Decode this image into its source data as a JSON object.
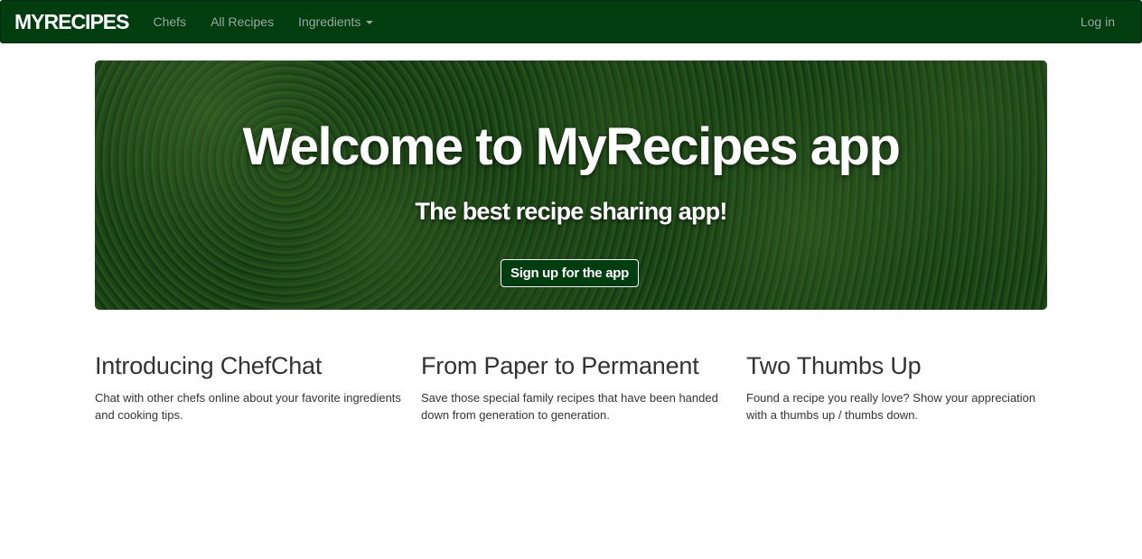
{
  "navbar": {
    "brand": "MYRECIPES",
    "links": [
      {
        "label": "Chefs"
      },
      {
        "label": "All Recipes"
      },
      {
        "label": "Ingredients"
      }
    ],
    "login": "Log in",
    "colors": {
      "background": "#003d0f",
      "link": "#9aa89d"
    }
  },
  "hero": {
    "title": "Welcome to MyRecipes app",
    "subtitle": "The best recipe sharing app!",
    "cta_label": "Sign up for the app"
  },
  "features": [
    {
      "title": "Introducing ChefChat",
      "text": "Chat with other chefs online about your favorite ingredients and cooking tips."
    },
    {
      "title": "From Paper to Permanent",
      "text": "Save those special family recipes that have been handed down from generation to generation."
    },
    {
      "title": "Two Thumbs Up",
      "text": "Found a recipe you really love? Show your appreciation with a thumbs up / thumbs down."
    }
  ]
}
